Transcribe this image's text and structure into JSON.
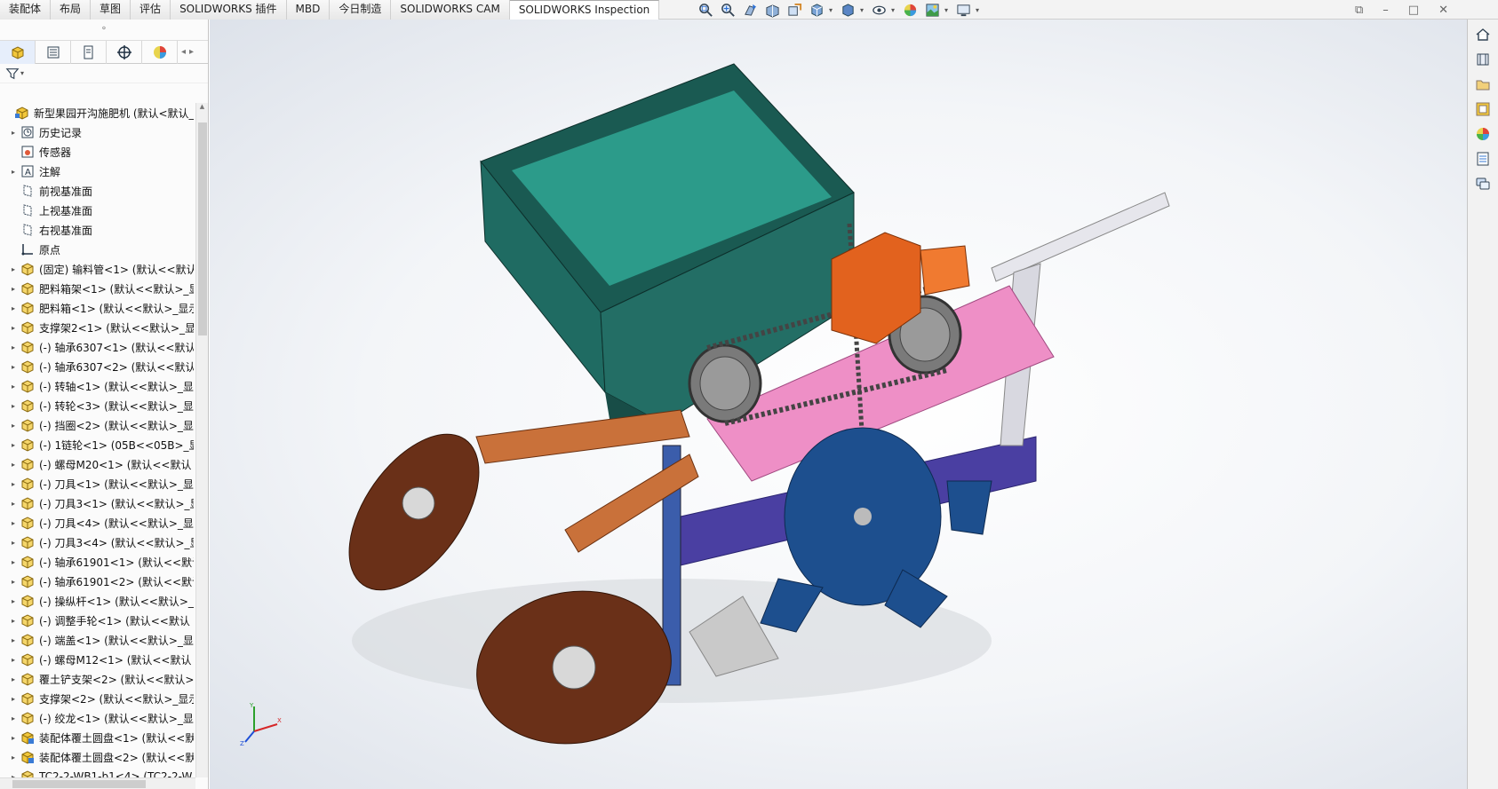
{
  "tabs": [
    "装配体",
    "布局",
    "草图",
    "评估",
    "SOLIDWORKS 插件",
    "MBD",
    "今日制造",
    "SOLIDWORKS CAM",
    "SOLIDWORKS Inspection"
  ],
  "active_tab": "SOLIDWORKS Inspection",
  "heads_up_toolbar": [
    "zoom-to-fit-icon",
    "zoom-to-area-icon",
    "previous-view-icon",
    "section-view-icon",
    "dynamic-annotation-icon",
    "view-orientation-icon",
    "display-style-icon",
    "hide-show-icon",
    "edit-appearance-icon",
    "apply-scene-icon",
    "view-settings-icon"
  ],
  "window_controls": [
    "restore-icon",
    "minimize-icon",
    "maximize-icon",
    "close-icon"
  ],
  "panel_tabs": [
    "featuremanager-tab",
    "propertymanager-tab",
    "configurationmanager-tab",
    "dimxpertmanager-tab",
    "displaymanager-tab"
  ],
  "tree": [
    {
      "label": "新型果园开沟施肥机  (默认<默认_显",
      "icon": "assembly",
      "arrow": "",
      "indent": 0
    },
    {
      "label": "历史记录",
      "icon": "history",
      "arrow": "▸",
      "indent": 1
    },
    {
      "label": "传感器",
      "icon": "sensor",
      "arrow": "",
      "indent": 1
    },
    {
      "label": "注解",
      "icon": "annotation",
      "arrow": "▸",
      "indent": 1
    },
    {
      "label": "前视基准面",
      "icon": "plane",
      "arrow": "",
      "indent": 1
    },
    {
      "label": "上视基准面",
      "icon": "plane",
      "arrow": "",
      "indent": 1
    },
    {
      "label": "右视基准面",
      "icon": "plane",
      "arrow": "",
      "indent": 1
    },
    {
      "label": "原点",
      "icon": "origin",
      "arrow": "",
      "indent": 1
    },
    {
      "label": "(固定) 输料管<1> (默认<<默认",
      "icon": "part",
      "arrow": "▸",
      "indent": 1
    },
    {
      "label": "肥料箱架<1> (默认<<默认>_显",
      "icon": "part",
      "arrow": "▸",
      "indent": 1
    },
    {
      "label": "肥料箱<1> (默认<<默认>_显示",
      "icon": "part",
      "arrow": "▸",
      "indent": 1
    },
    {
      "label": "支撑架2<1> (默认<<默认>_显",
      "icon": "part",
      "arrow": "▸",
      "indent": 1
    },
    {
      "label": "(-) 轴承6307<1> (默认<<默认",
      "icon": "part",
      "arrow": "▸",
      "indent": 1
    },
    {
      "label": "(-) 轴承6307<2> (默认<<默认",
      "icon": "part",
      "arrow": "▸",
      "indent": 1
    },
    {
      "label": "(-) 转轴<1> (默认<<默认>_显",
      "icon": "part",
      "arrow": "▸",
      "indent": 1
    },
    {
      "label": "(-) 转轮<3> (默认<<默认>_显",
      "icon": "part",
      "arrow": "▸",
      "indent": 1
    },
    {
      "label": "(-) 挡圈<2> (默认<<默认>_显",
      "icon": "part",
      "arrow": "▸",
      "indent": 1
    },
    {
      "label": "(-) 1链轮<1> (05B<<05B>_显",
      "icon": "part",
      "arrow": "▸",
      "indent": 1
    },
    {
      "label": "(-) 螺母M20<1> (默认<<默认",
      "icon": "part",
      "arrow": "▸",
      "indent": 1
    },
    {
      "label": "(-) 刀具<1> (默认<<默认>_显",
      "icon": "part",
      "arrow": "▸",
      "indent": 1
    },
    {
      "label": "(-) 刀具3<1> (默认<<默认>_显",
      "icon": "part",
      "arrow": "▸",
      "indent": 1
    },
    {
      "label": "(-) 刀具<4> (默认<<默认>_显",
      "icon": "part",
      "arrow": "▸",
      "indent": 1
    },
    {
      "label": "(-) 刀具3<4> (默认<<默认>_显",
      "icon": "part",
      "arrow": "▸",
      "indent": 1
    },
    {
      "label": "(-) 轴承61901<1> (默认<<默认",
      "icon": "part",
      "arrow": "▸",
      "indent": 1
    },
    {
      "label": "(-) 轴承61901<2> (默认<<默认",
      "icon": "part",
      "arrow": "▸",
      "indent": 1
    },
    {
      "label": "(-) 操纵杆<1> (默认<<默认>_",
      "icon": "part",
      "arrow": "▸",
      "indent": 1
    },
    {
      "label": "(-) 调整手轮<1> (默认<<默认",
      "icon": "part",
      "arrow": "▸",
      "indent": 1
    },
    {
      "label": "(-) 端盖<1> (默认<<默认>_显",
      "icon": "part",
      "arrow": "▸",
      "indent": 1
    },
    {
      "label": "(-) 螺母M12<1> (默认<<默认",
      "icon": "part",
      "arrow": "▸",
      "indent": 1
    },
    {
      "label": "覆土铲支架<2> (默认<<默认>",
      "icon": "part",
      "arrow": "▸",
      "indent": 1
    },
    {
      "label": "支撑架<2> (默认<<默认>_显示",
      "icon": "part",
      "arrow": "▸",
      "indent": 1
    },
    {
      "label": "(-) 绞龙<1> (默认<<默认>_显",
      "icon": "part",
      "arrow": "▸",
      "indent": 1
    },
    {
      "label": "装配体覆土圆盘<1> (默认<<默认",
      "icon": "subassembly",
      "arrow": "▸",
      "indent": 1
    },
    {
      "label": "装配体覆土圆盘<2> (默认<<默认",
      "icon": "subassembly",
      "arrow": "▸",
      "indent": 1
    },
    {
      "label": "TC2-2-WB1-b1<4> (TC2-2-W",
      "icon": "part",
      "arrow": "▸",
      "indent": 1
    }
  ],
  "task_pane": [
    "solidworks-resources-icon",
    "design-library-icon",
    "file-explorer-icon",
    "view-palette-icon",
    "appearances-icon",
    "custom-properties-icon",
    "forum-icon"
  ],
  "colors": {
    "hopper": "#1f6b62",
    "bracket": "#c9713a",
    "disc": "#6a3018",
    "gearbox": "#e2621e",
    "plate": "#ee8fc6",
    "frame": "#4a3fa2",
    "rotor": "#1d4f8e"
  }
}
